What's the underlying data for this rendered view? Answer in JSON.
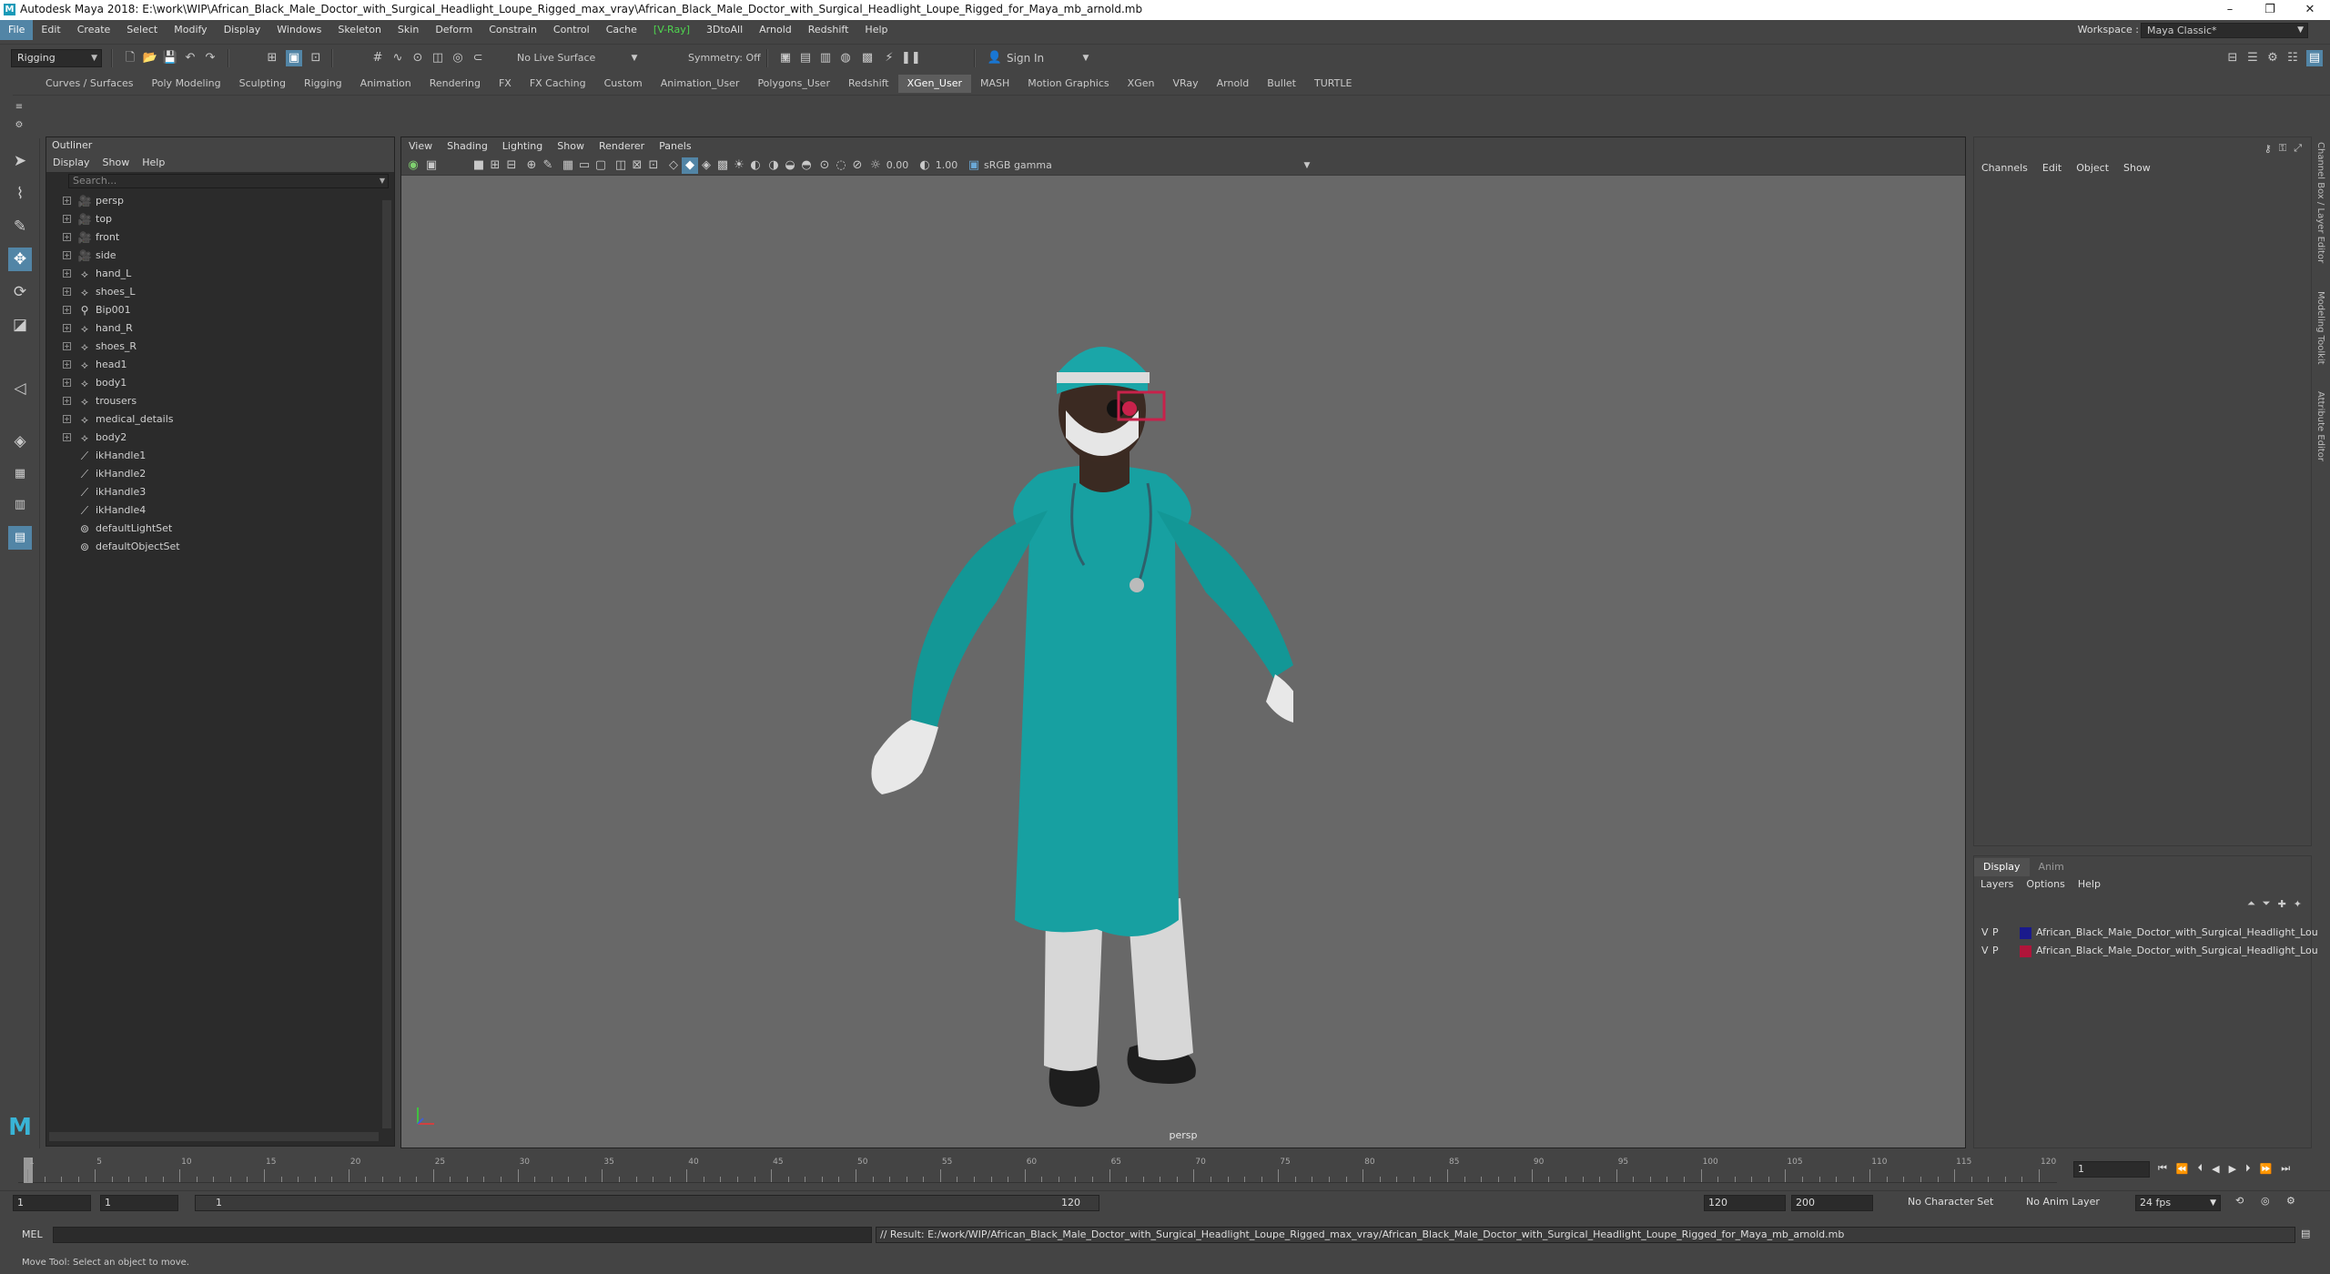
{
  "app": {
    "title": "Autodesk Maya 2018: E:\\work\\WIP\\African_Black_Male_Doctor_with_Surgical_Headlight_Loupe_Rigged_max_vray\\African_Black_Male_Doctor_with_Surgical_Headlight_Loupe_Rigged_for_Maya_mb_arnold.mb",
    "icon_letter": "M",
    "window_controls": [
      "–",
      "❐",
      "✕"
    ]
  },
  "menubar": {
    "items": [
      "File",
      "Edit",
      "Create",
      "Select",
      "Modify",
      "Display",
      "Windows",
      "Skeleton",
      "Skin",
      "Deform",
      "Constrain",
      "Control",
      "Cache",
      "[V-Ray]",
      "3DtoAll",
      "Arnold",
      "Redshift",
      "Help"
    ],
    "active_index": 0,
    "workspace_label": "Workspace :",
    "workspace_value": "Maya Classic*"
  },
  "statusline": {
    "menuset": "Rigging",
    "live_surface": "No Live Surface",
    "symmetry": "Symmetry: Off",
    "sign_in": "Sign In"
  },
  "shelf": {
    "tabs": [
      "Curves / Surfaces",
      "Poly Modeling",
      "Sculpting",
      "Rigging",
      "Animation",
      "Rendering",
      "FX",
      "FX Caching",
      "Custom",
      "Animation_User",
      "Polygons_User",
      "Redshift",
      "XGen_User",
      "MASH",
      "Motion Graphics",
      "XGen",
      "VRay",
      "Arnold",
      "Bullet",
      "TURTLE"
    ],
    "active_index": 12
  },
  "outliner": {
    "title": "Outliner",
    "menus": [
      "Display",
      "Show",
      "Help"
    ],
    "search_placeholder": "Search...",
    "nodes": [
      {
        "label": "persp",
        "icon": "camera-icon",
        "expandable": true
      },
      {
        "label": "top",
        "icon": "camera-icon",
        "expandable": true
      },
      {
        "label": "front",
        "icon": "camera-icon",
        "expandable": true
      },
      {
        "label": "side",
        "icon": "camera-icon",
        "expandable": true
      },
      {
        "label": "hand_L",
        "icon": "transform-icon",
        "expandable": true
      },
      {
        "label": "shoes_L",
        "icon": "transform-icon",
        "expandable": true
      },
      {
        "label": "Bip001",
        "icon": "joint-icon",
        "expandable": true
      },
      {
        "label": "hand_R",
        "icon": "transform-icon",
        "expandable": true
      },
      {
        "label": "shoes_R",
        "icon": "transform-icon",
        "expandable": true
      },
      {
        "label": "head1",
        "icon": "transform-icon",
        "expandable": true
      },
      {
        "label": "body1",
        "icon": "transform-icon",
        "expandable": true
      },
      {
        "label": "trousers",
        "icon": "transform-icon",
        "expandable": true
      },
      {
        "label": "medical_details",
        "icon": "transform-icon",
        "expandable": true
      },
      {
        "label": "body2",
        "icon": "transform-icon",
        "expandable": true
      },
      {
        "label": "ikHandle1",
        "icon": "ikhandle-icon",
        "expandable": false
      },
      {
        "label": "ikHandle2",
        "icon": "ikhandle-icon",
        "expandable": false
      },
      {
        "label": "ikHandle3",
        "icon": "ikhandle-icon",
        "expandable": false
      },
      {
        "label": "ikHandle4",
        "icon": "ikhandle-icon",
        "expandable": false
      },
      {
        "label": "defaultLightSet",
        "icon": "set-icon",
        "expandable": false
      },
      {
        "label": "defaultObjectSet",
        "icon": "set-icon",
        "expandable": false
      }
    ]
  },
  "viewport": {
    "menus": [
      "View",
      "Shading",
      "Lighting",
      "Show",
      "Renderer",
      "Panels"
    ],
    "exposure": "0.00",
    "gamma": "1.00",
    "color_space": "sRGB gamma",
    "camera_label": "persp"
  },
  "channelbox": {
    "menus": [
      "Channels",
      "Edit",
      "Object",
      "Show"
    ]
  },
  "side_tabs": [
    "Channel Box / Layer Editor",
    "Modeling Toolkit",
    "Attribute Editor"
  ],
  "layer_editor": {
    "tabs": [
      "Display",
      "Anim"
    ],
    "menus": [
      "Layers",
      "Options",
      "Help"
    ],
    "layers": [
      {
        "v": "V",
        "p": "P",
        "color": "#1a1a8c",
        "name": "African_Black_Male_Doctor_with_Surgical_Headlight_Lou"
      },
      {
        "v": "V",
        "p": "P",
        "color": "#b0153a",
        "name": "African_Black_Male_Doctor_with_Surgical_Headlight_Lou"
      }
    ]
  },
  "timeline": {
    "labels": [
      "1",
      "5",
      "10",
      "15",
      "20",
      "25",
      "30",
      "35",
      "40",
      "45",
      "50",
      "55",
      "60",
      "65",
      "70",
      "75",
      "80",
      "85",
      "90",
      "95",
      "100",
      "105",
      "110",
      "115",
      "120"
    ],
    "current_frame": "1"
  },
  "range": {
    "start": "1",
    "playback_start": "1",
    "slider_start": "1",
    "slider_end": "120",
    "playback_end": "120",
    "end": "200",
    "character_set": "No Character Set",
    "anim_layer": "No Anim Layer",
    "fps": "24 fps"
  },
  "command": {
    "lang": "MEL",
    "result": "// Result: E:/work/WIP/African_Black_Male_Doctor_with_Surgical_Headlight_Loupe_Rigged_max_vray/African_Black_Male_Doctor_with_Surgical_Headlight_Loupe_Rigged_for_Maya_mb_arnold.mb"
  },
  "helpline": {
    "text": "Move Tool: Select an object to move."
  },
  "colors": {
    "accent": "#5285a6",
    "panel": "#444444",
    "viewport_bg": "#686868",
    "scrubs": "#14a6a0"
  }
}
